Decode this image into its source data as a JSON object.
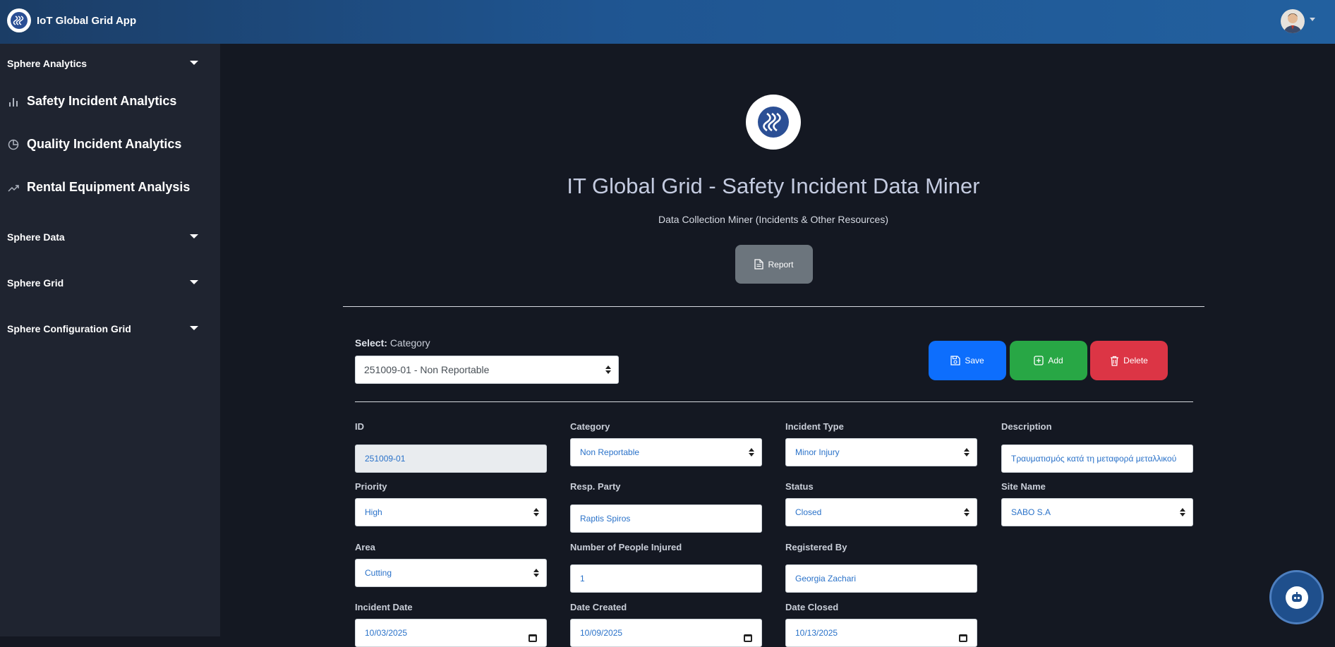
{
  "app": {
    "title": "IoT Global Grid App"
  },
  "sidebar": {
    "sections": [
      {
        "label": "Sphere Analytics",
        "icon": "chevron-down-icon"
      },
      {
        "label": "Sphere Data",
        "icon": "chevron-down-icon"
      },
      {
        "label": "Sphere Grid",
        "icon": "chevron-down-icon"
      },
      {
        "label": "Sphere Configuration Grid",
        "icon": "chevron-down-icon"
      }
    ],
    "links": [
      {
        "label": "Safety Incident Analytics",
        "icon": "bar-chart-icon"
      },
      {
        "label": "Quality Incident Analytics",
        "icon": "pie-chart-icon"
      },
      {
        "label": "Rental Equipment Analysis",
        "icon": "trend-up-icon"
      }
    ]
  },
  "header": {
    "title": "IT Global Grid - Safety Incident Data Miner",
    "subtitle": "Data Collection Miner (Incidents & Other Resources)",
    "report_label": "Report"
  },
  "selector": {
    "label_bold": "Select:",
    "label": "Category",
    "value": "251009-01 - Non Reportable"
  },
  "actions": {
    "save": "Save",
    "add": "Add",
    "delete": "Delete"
  },
  "form": {
    "id": {
      "label": "ID",
      "value": "251009-01"
    },
    "category": {
      "label": "Category",
      "value": "Non Reportable"
    },
    "incident_type": {
      "label": "Incident Type",
      "value": "Minor Injury"
    },
    "description": {
      "label": "Description",
      "value": "Τραυματισμός κατά τη μεταφορά μεταλλικού"
    },
    "priority": {
      "label": "Priority",
      "value": "High"
    },
    "resp_party": {
      "label": "Resp. Party",
      "value": "Raptis Spiros"
    },
    "status": {
      "label": "Status",
      "value": "Closed"
    },
    "site_name": {
      "label": "Site Name",
      "value": "SABO S.A"
    },
    "area": {
      "label": "Area",
      "value": "Cutting"
    },
    "people_injured": {
      "label": "Number of People Injured",
      "value": "1"
    },
    "registered_by": {
      "label": "Registered By",
      "value": "Georgia Zachari"
    },
    "incident_date": {
      "label": "Incident Date",
      "value": "10/03/2025"
    },
    "date_created": {
      "label": "Date Created",
      "value": "10/09/2025"
    },
    "date_closed": {
      "label": "Date Closed",
      "value": "10/13/2025"
    }
  },
  "colors": {
    "topbar": "#1f5591",
    "sidebar": "#1f2430",
    "background": "#141822",
    "save": "#0d6efd",
    "add": "#28a745",
    "delete": "#dc3545",
    "report": "#6c757d",
    "field_text": "#2a72c9"
  }
}
